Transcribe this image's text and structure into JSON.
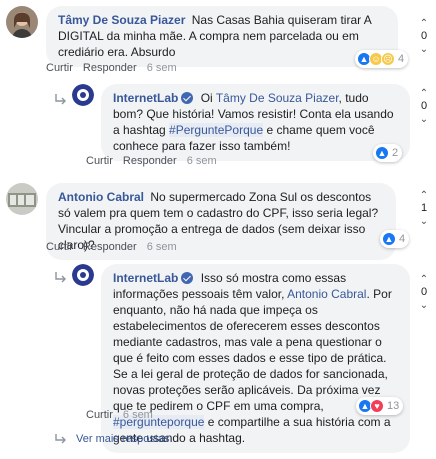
{
  "comments": [
    {
      "author": "Tâmy De Souza Piazer",
      "text": "Nas Casas Bahia quiseram tirar A DIGITAL da minha mãe. A compra nem parcelada ou em crediário era. Absurdo",
      "actions": {
        "like": "Curtir",
        "reply": "Responder",
        "time": "6 sem"
      },
      "reactions_count": "4",
      "vote": {
        "up": "^",
        "count": "0",
        "down": "v"
      }
    },
    {
      "author": "InternetLab",
      "text_pre": "Oi ",
      "mention": "Tâmy De Souza Piazer",
      "text_mid": ", tudo bom? Que história! Vamos resistir! Conta ela usando a hashtag ",
      "hashtag": "#PerguntePorque",
      "text_post": " e chame quem você conhece para fazer isso também!",
      "actions": {
        "like": "Curtir",
        "reply": "Responder",
        "time": "6 sem"
      },
      "reactions_count": "2",
      "vote": {
        "up": "^",
        "count": "0",
        "down": "v"
      }
    },
    {
      "author": "Antonio Cabral",
      "text": "No supermercado Zona Sul os descontos só valem pra quem tem o cadastro do CPF, isso seria legal? Vincular a promoção a entrega de dados (sem deixar isso claro)?",
      "actions": {
        "like": "Curtir",
        "reply": "Responder",
        "time": "6 sem"
      },
      "reactions_count": "4",
      "vote": {
        "up": "^",
        "count": "1",
        "down": "v"
      }
    },
    {
      "author": "InternetLab",
      "text_pre": "Isso só mostra como essas informações pessoais têm valor, ",
      "mention": "Antonio Cabral",
      "text_mid": ". Por enquanto, não há nada que impeça os estabelecimentos de oferecerem esses descontos mediante cadastros, mas vale a pena questionar o que é feito com esses dados e esse tipo de prática. Se a lei geral de proteção de dados for sancionada, novas proteções serão aplicáveis. Da próxima vez que te pedirem o CPF em uma compra, ",
      "hashtag": "#pergunteporque",
      "text_post": " e compartilhe a sua história com a gente usando a hashtag.",
      "actions": {
        "like": "Curtir",
        "time": "6 sem"
      },
      "reactions_count": "13",
      "vote": {
        "up": "^",
        "count": "0",
        "down": "v"
      }
    }
  ],
  "more_replies": "Ver mais respostas",
  "colors": {
    "link": "#385898",
    "bubble": "#f2f3f5",
    "like": "#1877f2",
    "love": "#f33e58"
  },
  "icons": {
    "like": "thumbs-up-icon",
    "haha": "haha-icon",
    "sad": "sad-icon",
    "love": "heart-icon",
    "reply_arrow": "reply-arrow-icon"
  }
}
